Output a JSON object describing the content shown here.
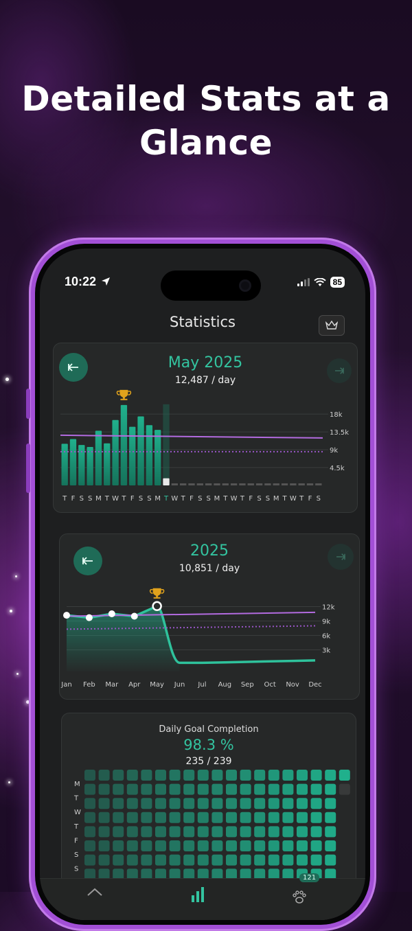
{
  "headline": "Detailed Stats at a Glance",
  "status": {
    "time": "10:22",
    "battery": "85"
  },
  "header": {
    "title": "Statistics"
  },
  "colors": {
    "accent": "#33c4a0",
    "goal": "#b36be0",
    "bar_active": "#20b08c",
    "bg": "#1e1f20"
  },
  "monthly": {
    "title": "May 2025",
    "subtitle": "12,487 / day",
    "y_ticks": [
      "18k",
      "13.5k",
      "9k",
      "4.5k"
    ],
    "day_labels": [
      "T",
      "F",
      "S",
      "S",
      "M",
      "T",
      "W",
      "T",
      "F",
      "S",
      "S",
      "M",
      "T",
      "W",
      "T",
      "F",
      "S",
      "S",
      "M",
      "T",
      "W",
      "T",
      "F",
      "S",
      "S",
      "M",
      "T",
      "W",
      "T",
      "F",
      "S"
    ]
  },
  "yearly": {
    "title": "2025",
    "subtitle": "10,851 / day",
    "y_ticks": [
      "12k",
      "9k",
      "6k",
      "3k"
    ],
    "month_labels": [
      "Jan",
      "Feb",
      "Mar",
      "Apr",
      "May",
      "Jun",
      "Jul",
      "Aug",
      "Sep",
      "Oct",
      "Nov",
      "Dec"
    ]
  },
  "goal": {
    "title": "Daily Goal Completion",
    "percent": "98.3 %",
    "ratio": "235 / 239",
    "weekday_labels": [
      "M",
      "T",
      "W",
      "T",
      "F",
      "S",
      "S"
    ]
  },
  "tabs": {
    "pets_badge": "121",
    "home_icon": "home-icon",
    "stats_icon": "bar-chart-icon",
    "pets_icon": "paw-icon"
  },
  "chart_data": [
    {
      "type": "bar",
      "title": "May 2025",
      "categories": [
        "1",
        "2",
        "3",
        "4",
        "5",
        "6",
        "7",
        "8",
        "9",
        "10",
        "11",
        "12",
        "13",
        "14",
        "15",
        "16",
        "17",
        "18",
        "19",
        "20",
        "21",
        "22",
        "23",
        "24",
        "25",
        "26",
        "27",
        "28",
        "29",
        "30",
        "31"
      ],
      "values": [
        10500,
        11700,
        10200,
        9700,
        13800,
        10600,
        16500,
        20300,
        14800,
        17400,
        15200,
        14000,
        1800,
        0,
        0,
        0,
        0,
        0,
        0,
        0,
        0,
        0,
        0,
        0,
        0,
        0,
        0,
        0,
        0,
        0,
        0
      ],
      "highlight_index": 7,
      "goal_line": 12487,
      "average_line": 8500,
      "ylim": [
        0,
        22000
      ],
      "y_ticks": [
        4500,
        9000,
        13500,
        18000
      ]
    },
    {
      "type": "area",
      "title": "2025",
      "categories": [
        "Jan",
        "Feb",
        "Mar",
        "Apr",
        "May",
        "Jun",
        "Jul",
        "Aug",
        "Sep",
        "Oct",
        "Nov",
        "Dec"
      ],
      "values": [
        10200,
        9700,
        10500,
        10000,
        12100,
        300,
        300,
        400,
        500,
        600,
        700,
        800
      ],
      "highlight_index": 4,
      "goal_line_start": 10000,
      "goal_line_end": 10800,
      "average_line_start": 7300,
      "average_line_end": 8000,
      "ylim": [
        -1500,
        13500
      ],
      "y_ticks": [
        3000,
        6000,
        9000,
        12000
      ]
    }
  ]
}
